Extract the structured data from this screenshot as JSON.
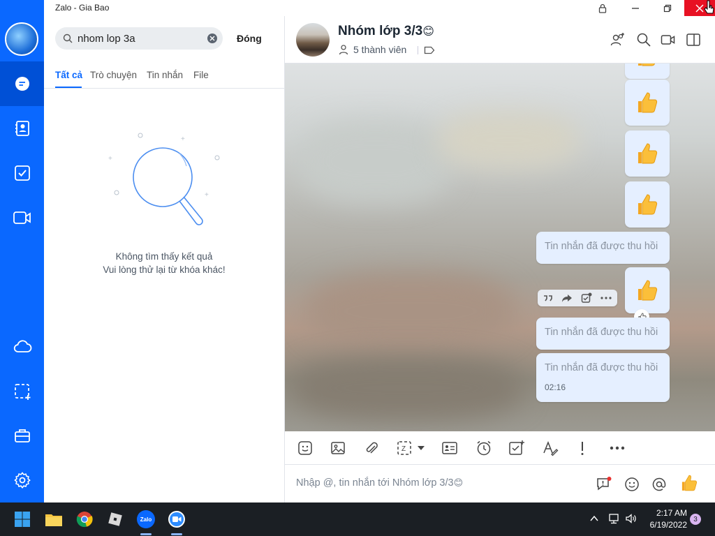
{
  "window": {
    "title": "Zalo - Gia Bao"
  },
  "nav": {
    "items": [
      "avatar",
      "chat-icon",
      "contacts-icon",
      "todo-icon",
      "video-icon",
      "cloud-icon",
      "screenshot-icon",
      "toolbox-icon",
      "settings-icon"
    ],
    "accent": "#0a68ff"
  },
  "search": {
    "value": "nhom lop 3a",
    "close_label": "Đóng",
    "tabs": [
      "Tất cả",
      "Trò chuyện",
      "Tin nhắn",
      "File"
    ],
    "empty_line1": "Không tìm thấy kết quả",
    "empty_line2": "Vui lòng thử lại từ khóa khác!"
  },
  "chat": {
    "name": "Nhóm lớp 3/3",
    "name_emoji": "😊",
    "members": "5 thành viên",
    "recalled_text": "Tin nhắn đã được thu hồi",
    "last_time": "02:16",
    "input_placeholder": "Nhập @, tin nhắn tới Nhóm lớp 3/3",
    "input_emoji": "😊"
  },
  "taskbar": {
    "time": "2:17 AM",
    "date": "6/19/2022",
    "notification_count": "3",
    "zalo_label": "Zalo"
  }
}
